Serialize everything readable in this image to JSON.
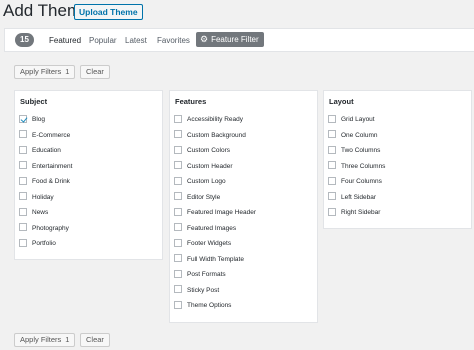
{
  "header": {
    "title": "Add Themes",
    "upload_label": "Upload Theme"
  },
  "filter_bar": {
    "count": "15",
    "tabs": [
      "Featured",
      "Popular",
      "Latest",
      "Favorites"
    ],
    "feature_filter_label": "Feature Filter",
    "gear_icon": "gear-icon"
  },
  "actions": {
    "apply_label": "Apply Filters",
    "apply_count": "1",
    "clear_label": "Clear"
  },
  "subject": {
    "title": "Subject",
    "items": [
      {
        "label": "Blog",
        "checked": true
      },
      {
        "label": "E-Commerce",
        "checked": false
      },
      {
        "label": "Education",
        "checked": false
      },
      {
        "label": "Entertainment",
        "checked": false
      },
      {
        "label": "Food & Drink",
        "checked": false
      },
      {
        "label": "Holiday",
        "checked": false
      },
      {
        "label": "News",
        "checked": false
      },
      {
        "label": "Photography",
        "checked": false
      },
      {
        "label": "Portfolio",
        "checked": false
      }
    ]
  },
  "features": {
    "title": "Features",
    "items": [
      {
        "label": "Accessibility Ready",
        "checked": false
      },
      {
        "label": "Custom Background",
        "checked": false
      },
      {
        "label": "Custom Colors",
        "checked": false
      },
      {
        "label": "Custom Header",
        "checked": false
      },
      {
        "label": "Custom Logo",
        "checked": false
      },
      {
        "label": "Editor Style",
        "checked": false
      },
      {
        "label": "Featured Image Header",
        "checked": false
      },
      {
        "label": "Featured Images",
        "checked": false
      },
      {
        "label": "Footer Widgets",
        "checked": false
      },
      {
        "label": "Full Width Template",
        "checked": false
      },
      {
        "label": "Post Formats",
        "checked": false
      },
      {
        "label": "Sticky Post",
        "checked": false
      },
      {
        "label": "Theme Options",
        "checked": false
      }
    ]
  },
  "layout": {
    "title": "Layout",
    "items": [
      {
        "label": "Grid Layout",
        "checked": false
      },
      {
        "label": "One Column",
        "checked": false
      },
      {
        "label": "Two Columns",
        "checked": false
      },
      {
        "label": "Three Columns",
        "checked": false
      },
      {
        "label": "Four Columns",
        "checked": false
      },
      {
        "label": "Left Sidebar",
        "checked": false
      },
      {
        "label": "Right Sidebar",
        "checked": false
      }
    ]
  },
  "colors": {
    "accent": "#0073aa",
    "badge": "#72777c",
    "checkmark": "#1e8cbe"
  }
}
